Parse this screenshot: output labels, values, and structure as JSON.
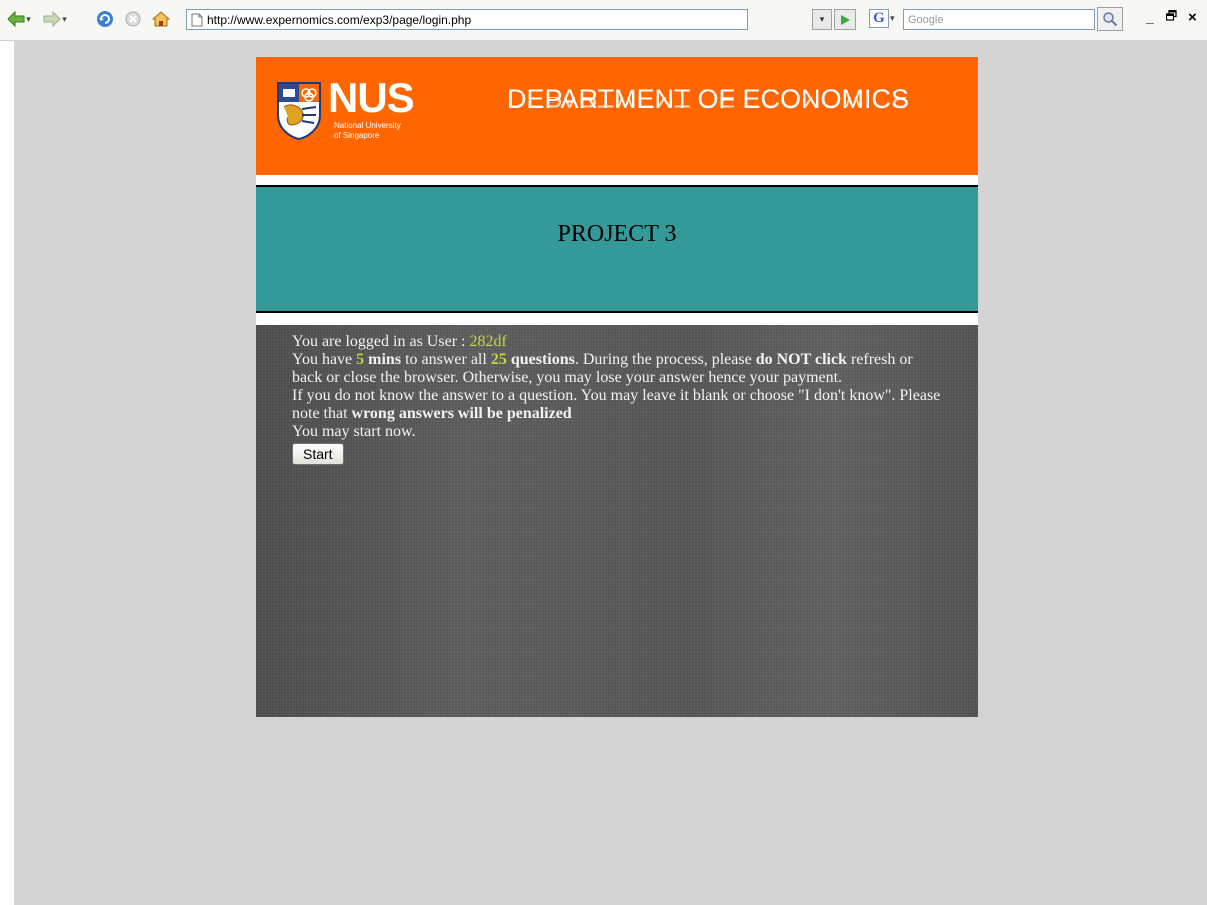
{
  "browser": {
    "url": "http://www.expernomics.com/exp3/page/login.php",
    "search_placeholder": "Google",
    "search_engine_letter": "G",
    "window_controls": {
      "minimize": "_",
      "restore": "ƒ",
      "close": "×"
    }
  },
  "banner": {
    "nus_word": "NUS",
    "nus_sub1": "National University",
    "nus_sub2": "of Singapore",
    "department": "DEPARTMENT OF ECONOMICS"
  },
  "title_band": {
    "title": "PROJECT 3"
  },
  "content": {
    "line1_prefix": "You are logged in as User : ",
    "user_id": "282df",
    "line2_a": "You have ",
    "mins_value": "5",
    "line2_mins": " mins",
    "line2_b": " to answer all ",
    "questions_value": "25",
    "line2_questions": " questions",
    "line2_c": ". During the process, please ",
    "line2_donot": "do NOT click",
    "line2_d": " refresh or back or close the browser. Otherwise, you may lose your answer hence your payment.",
    "line3_a": "If you do not know the answer to a question. You may leave it blank or choose \"I don't know\". Please note that ",
    "line3_bold": "wrong answers will be penalized",
    "line4": "You may start now.",
    "start_label": "Start"
  },
  "colors": {
    "banner": "#ff6600",
    "title_band": "#339999",
    "content_bg": "#5a5a5a",
    "highlight": "#c7d63b",
    "page_bg": "#d4d4d4"
  },
  "icons": {
    "back": "back-arrow-icon",
    "forward": "forward-arrow-icon",
    "reload": "reload-icon",
    "stop": "stop-icon",
    "home": "home-icon",
    "page": "page-icon",
    "go": "go-arrow-icon",
    "search": "magnifier-icon",
    "crest": "nus-crest-icon"
  }
}
